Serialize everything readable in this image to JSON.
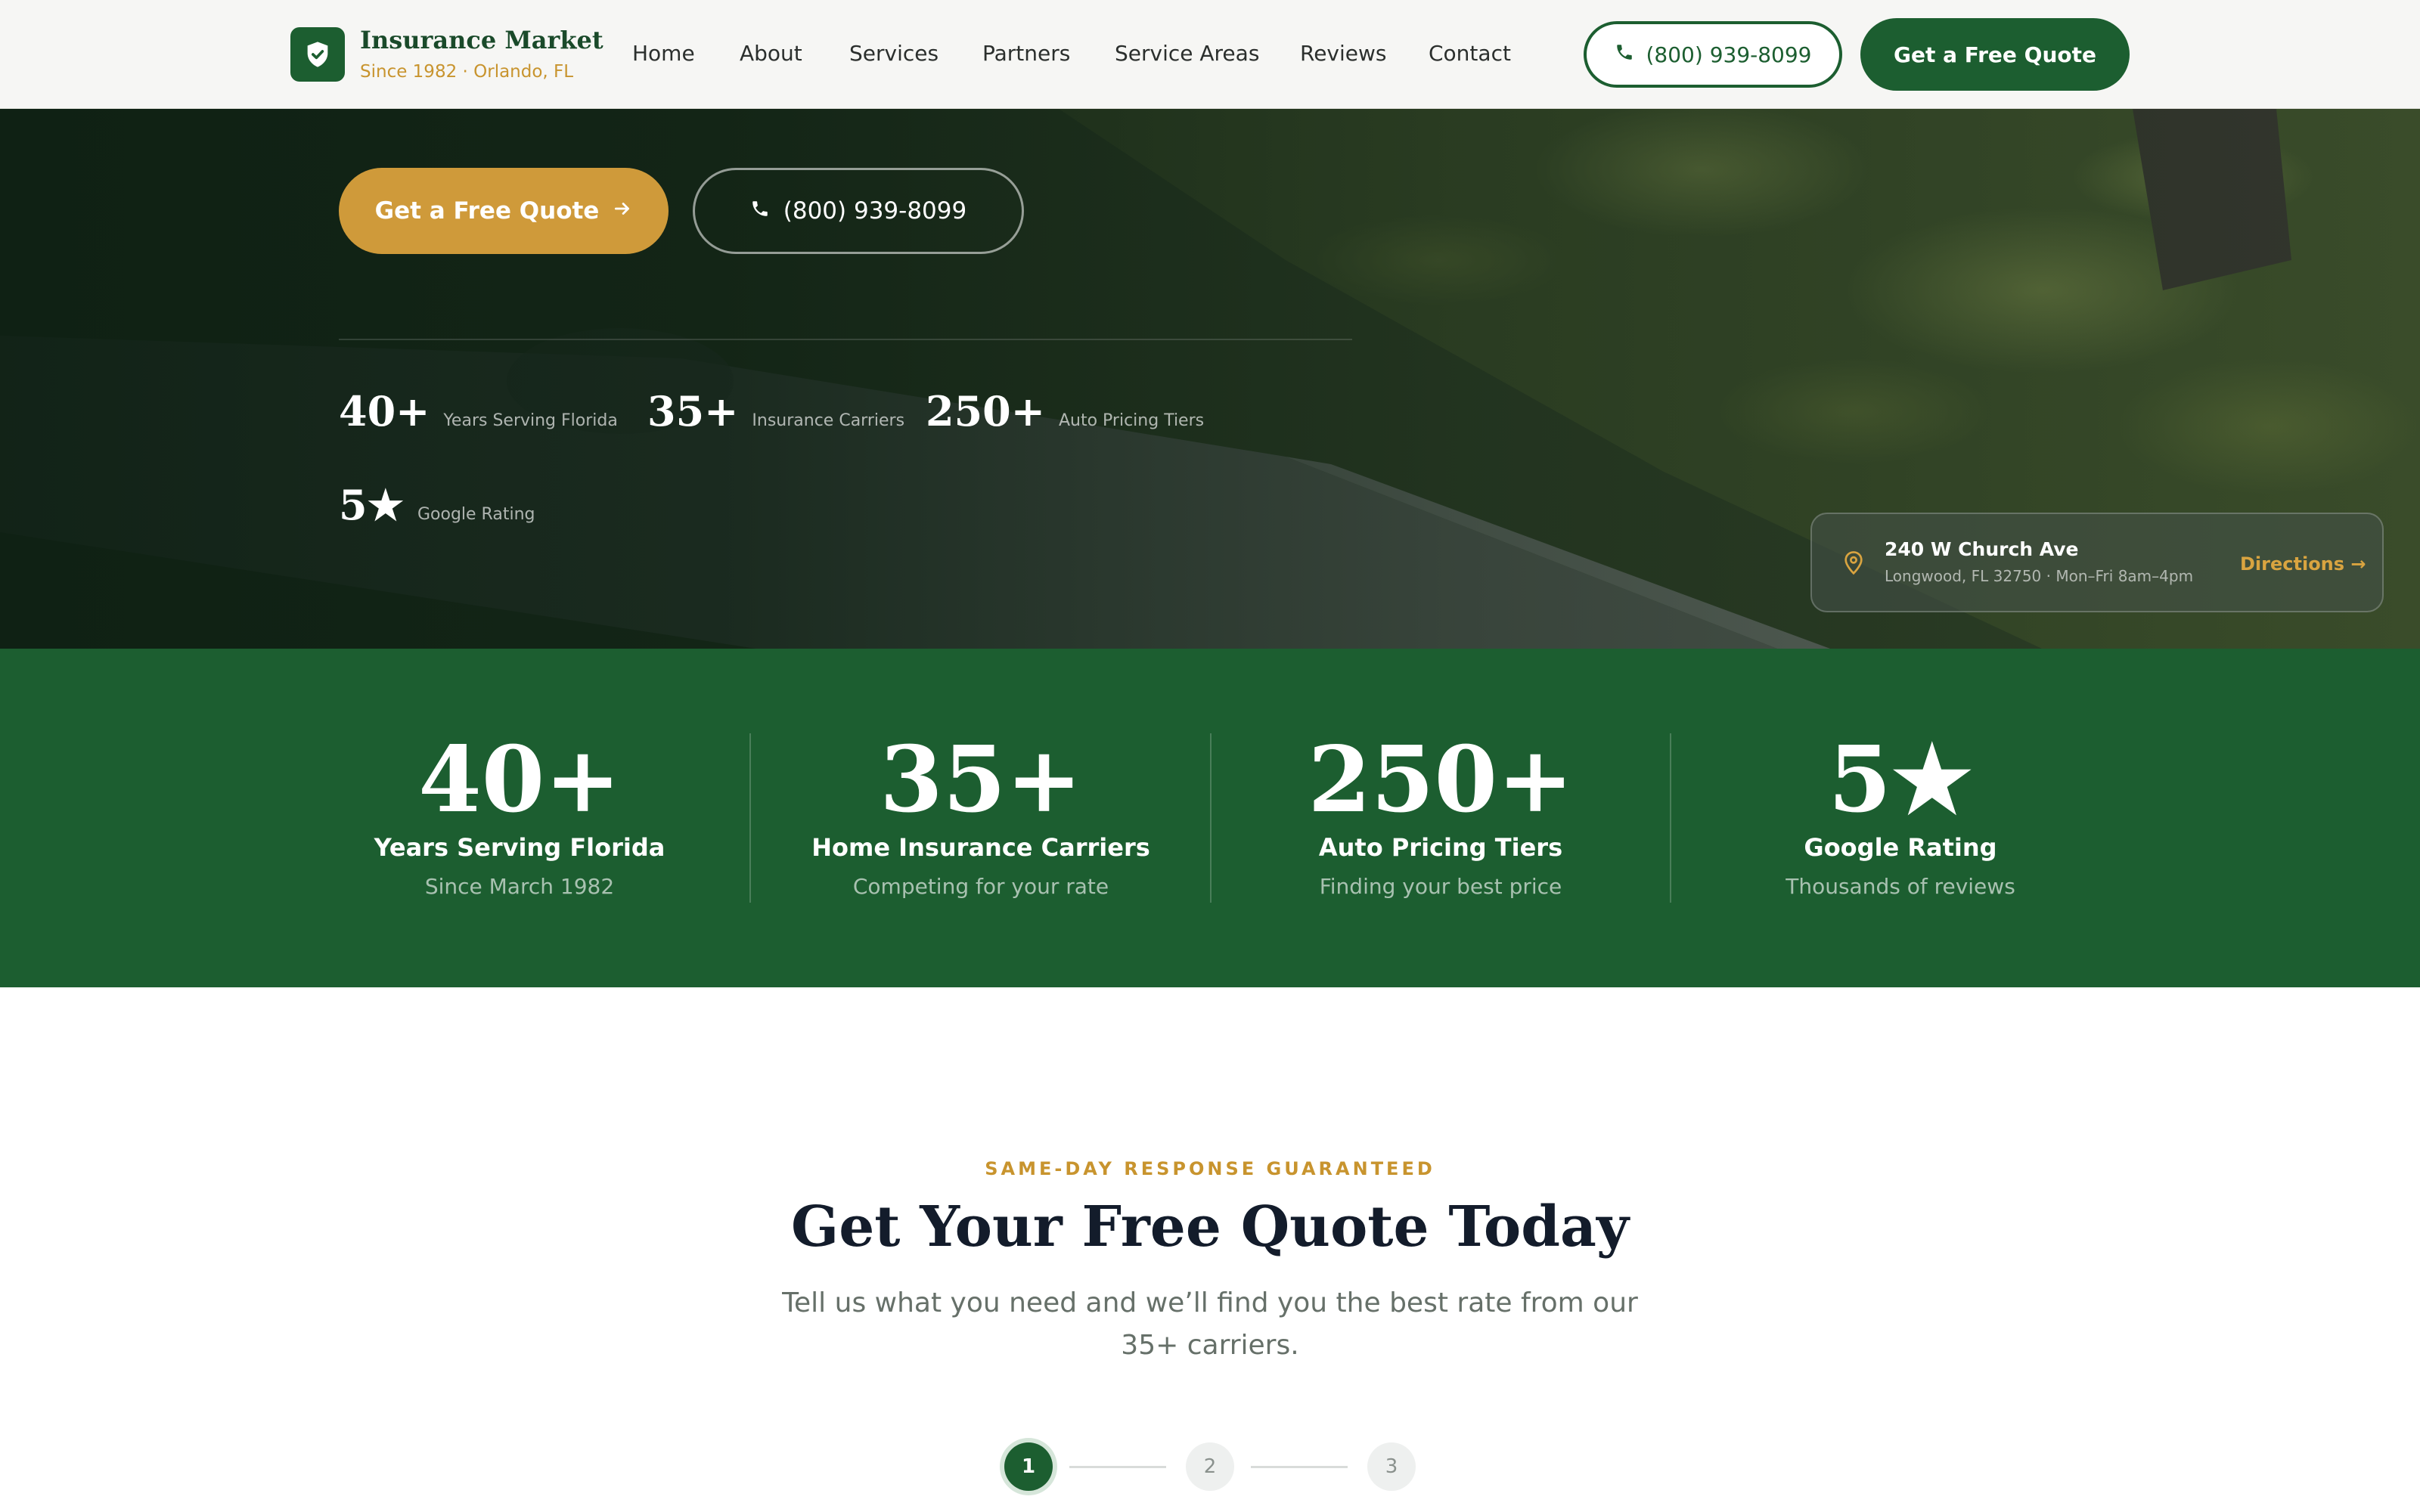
{
  "header": {
    "brand_name": "Insurance Market",
    "brand_tagline": "Since 1982 · Orlando, FL",
    "nav": [
      "Home",
      "About",
      "Services",
      "Partners",
      "Service Areas",
      "Reviews",
      "Contact"
    ],
    "phone": "(800) 939-8099",
    "quote_button": "Get a Free Quote"
  },
  "hero": {
    "cta_label": "Get a Free Quote",
    "phone_label": "(800) 939-8099",
    "stats": [
      {
        "num": "40+",
        "label": "Years Serving Florida"
      },
      {
        "num": "35+",
        "label": "Insurance Carriers"
      },
      {
        "num": "250+",
        "label": "Auto Pricing Tiers"
      },
      {
        "num": "5★",
        "label": "Google Rating"
      }
    ],
    "address": {
      "street": "240 W Church Ave",
      "meta": "Longwood, FL 32750 · Mon–Fri 8am–4pm",
      "directions": "Directions →"
    }
  },
  "stats_band": [
    {
      "num": "40+",
      "title": "Years Serving Florida",
      "sub": "Since March 1982"
    },
    {
      "num": "35+",
      "title": "Home Insurance Carriers",
      "sub": "Competing for your rate"
    },
    {
      "num": "250+",
      "title": "Auto Pricing Tiers",
      "sub": "Finding your best price"
    },
    {
      "num": "5★",
      "title": "Google Rating",
      "sub": "Thousands of reviews"
    }
  ],
  "quote": {
    "eyebrow": "SAME-DAY RESPONSE GUARANTEED",
    "title": "Get Your Free Quote Today",
    "subtitle": "Tell us what you need and we’ll find you the best rate from our 35+ carriers.",
    "steps": [
      "1",
      "2",
      "3"
    ],
    "active_step": 1
  },
  "colors": {
    "brand_green": "#1c5e30",
    "gold_accent": "#cf9a3a",
    "heading_navy": "#131c2b"
  },
  "icons": [
    "shield-check-icon",
    "phone-icon",
    "arrow-right-icon",
    "map-pin-icon"
  ]
}
